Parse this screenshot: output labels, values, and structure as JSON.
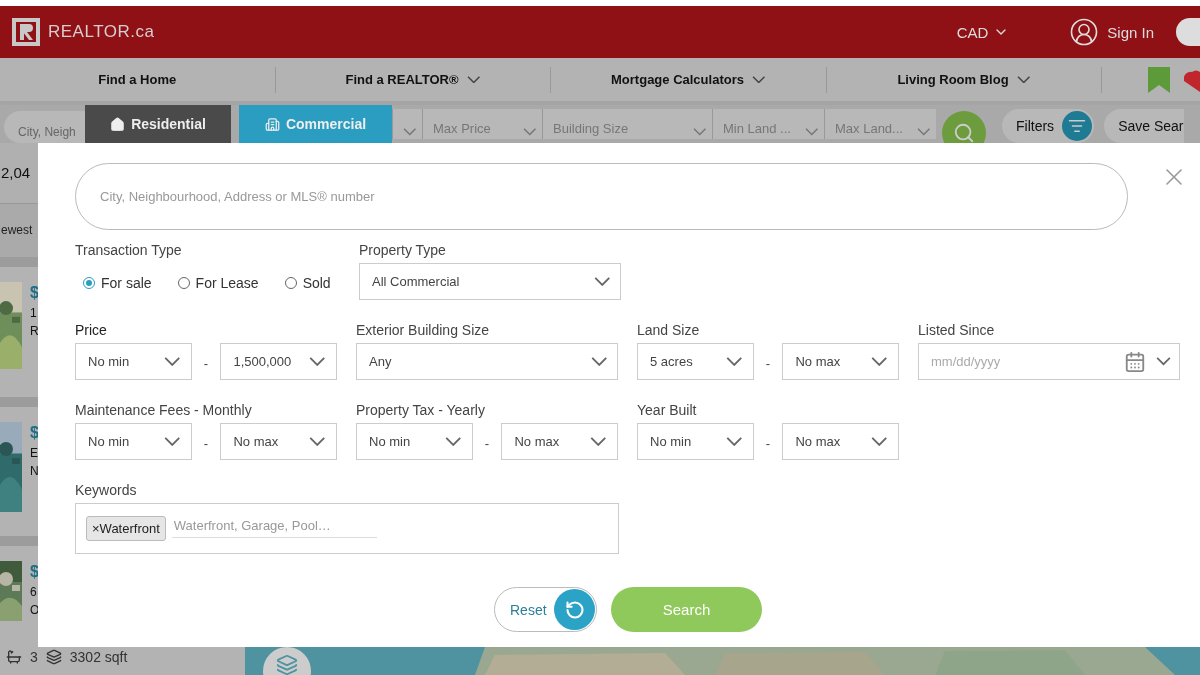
{
  "header": {
    "logo_text": "REALTOR.ca",
    "currency": "CAD",
    "sign_in": "Sign In"
  },
  "nav": [
    {
      "label": "Find a Home",
      "dropdown": false
    },
    {
      "label": "Find a REALTOR®",
      "dropdown": true
    },
    {
      "label": "Mortgage Calculators",
      "dropdown": true
    },
    {
      "label": "Living Room Blog",
      "dropdown": true
    }
  ],
  "search_bar": {
    "placeholder": "City, Neigh"
  },
  "listing_tabs": [
    {
      "label": "Residential",
      "kind": "house",
      "selected": false
    },
    {
      "label": "Commercial",
      "kind": "building",
      "selected": true
    }
  ],
  "filter_bar": {
    "fields": [
      "Max Price",
      "Building Size",
      "Min Land ...",
      "Max Land..."
    ],
    "filters_button": "Filters",
    "save_search": "Save Sear"
  },
  "results": {
    "count": "2,04",
    "sort": "ewest",
    "listings": [
      {
        "price": "$",
        "line_1": "1",
        "line_2": "R"
      },
      {
        "price": "$",
        "line_1": "E",
        "line_2": "N"
      },
      {
        "price": "$",
        "line_1": "6",
        "line_2": "O"
      }
    ],
    "beds": "3",
    "area": "3302 sqft"
  },
  "modal": {
    "search": {
      "placeholder": "City, Neighbourhood, Address or MLS® number"
    },
    "transaction_type": {
      "label": "Transaction Type",
      "options": [
        {
          "label": "For sale",
          "selected": true
        },
        {
          "label": "For Lease",
          "selected": false
        },
        {
          "label": "Sold",
          "selected": false
        }
      ]
    },
    "property_type": {
      "label": "Property Type",
      "value": "All Commercial"
    },
    "filters": [
      {
        "kind": "range",
        "label": "Price",
        "min": "No min",
        "separator": "-",
        "max": "1,500,000"
      },
      {
        "kind": "single",
        "label": "Exterior Building Size",
        "value": "Any"
      },
      {
        "kind": "range",
        "label": "Land Size",
        "min": "5 acres",
        "separator": "-",
        "max": "No max"
      },
      {
        "kind": "date",
        "label": "Listed Since",
        "placeholder": "mm/dd/yyyy"
      },
      {
        "kind": "range",
        "label": "Maintenance Fees - Monthly",
        "min": "No min",
        "separator": "-",
        "max": "No max"
      },
      {
        "kind": "range",
        "label": "Property Tax - Yearly",
        "min": "No min",
        "separator": "-",
        "max": "No max"
      },
      {
        "kind": "range",
        "label": "Year Built",
        "min": "No min",
        "separator": "-",
        "max": "No max"
      }
    ],
    "keywords": {
      "label": "Keywords",
      "tags": [
        {
          "remove": "×",
          "label": "Waterfront"
        }
      ],
      "placeholder": "Waterfront, Garage, Pool…"
    },
    "reset_button": "Reset",
    "search_button": "Search"
  }
}
